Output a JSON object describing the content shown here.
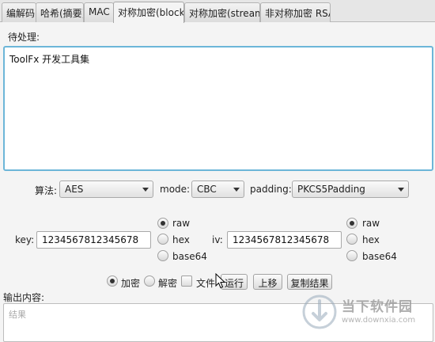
{
  "tabs": [
    {
      "label": "编解码"
    },
    {
      "label": "哈希(摘要)"
    },
    {
      "label": "MAC"
    },
    {
      "label": "对称加密(block)"
    },
    {
      "label": "对称加密(stream)"
    },
    {
      "label": "非对称加密 RSA"
    }
  ],
  "active_tab": "对称加密(block)",
  "input": {
    "label": "待处理:",
    "value": "ToolFx 开发工具集"
  },
  "options": {
    "algorithm_label": "算法:",
    "algorithm_value": "AES",
    "mode_label": "mode:",
    "mode_value": "CBC",
    "padding_label": "padding:",
    "padding_value": "PKCS5Padding"
  },
  "key": {
    "label": "key:",
    "value": "1234567812345678",
    "formats": [
      "raw",
      "hex",
      "base64"
    ],
    "selected": "raw"
  },
  "iv": {
    "label": "iv:",
    "value": "1234567812345678",
    "formats": [
      "raw",
      "hex",
      "base64"
    ],
    "selected": "raw"
  },
  "actions": {
    "encrypt_label": "加密",
    "decrypt_label": "解密",
    "file_label": "文件",
    "run_label": "运行",
    "move_up_label": "上移",
    "copy_result_label": "复制结果",
    "selected_mode": "加密",
    "file_checked": false
  },
  "output": {
    "label": "输出内容:",
    "placeholder": "结果"
  },
  "watermark": {
    "title": "当下软件园",
    "url": "www.downxia.com"
  },
  "colors": {
    "focus_border": "#6cb6d8",
    "background": "#f4f4f4"
  }
}
